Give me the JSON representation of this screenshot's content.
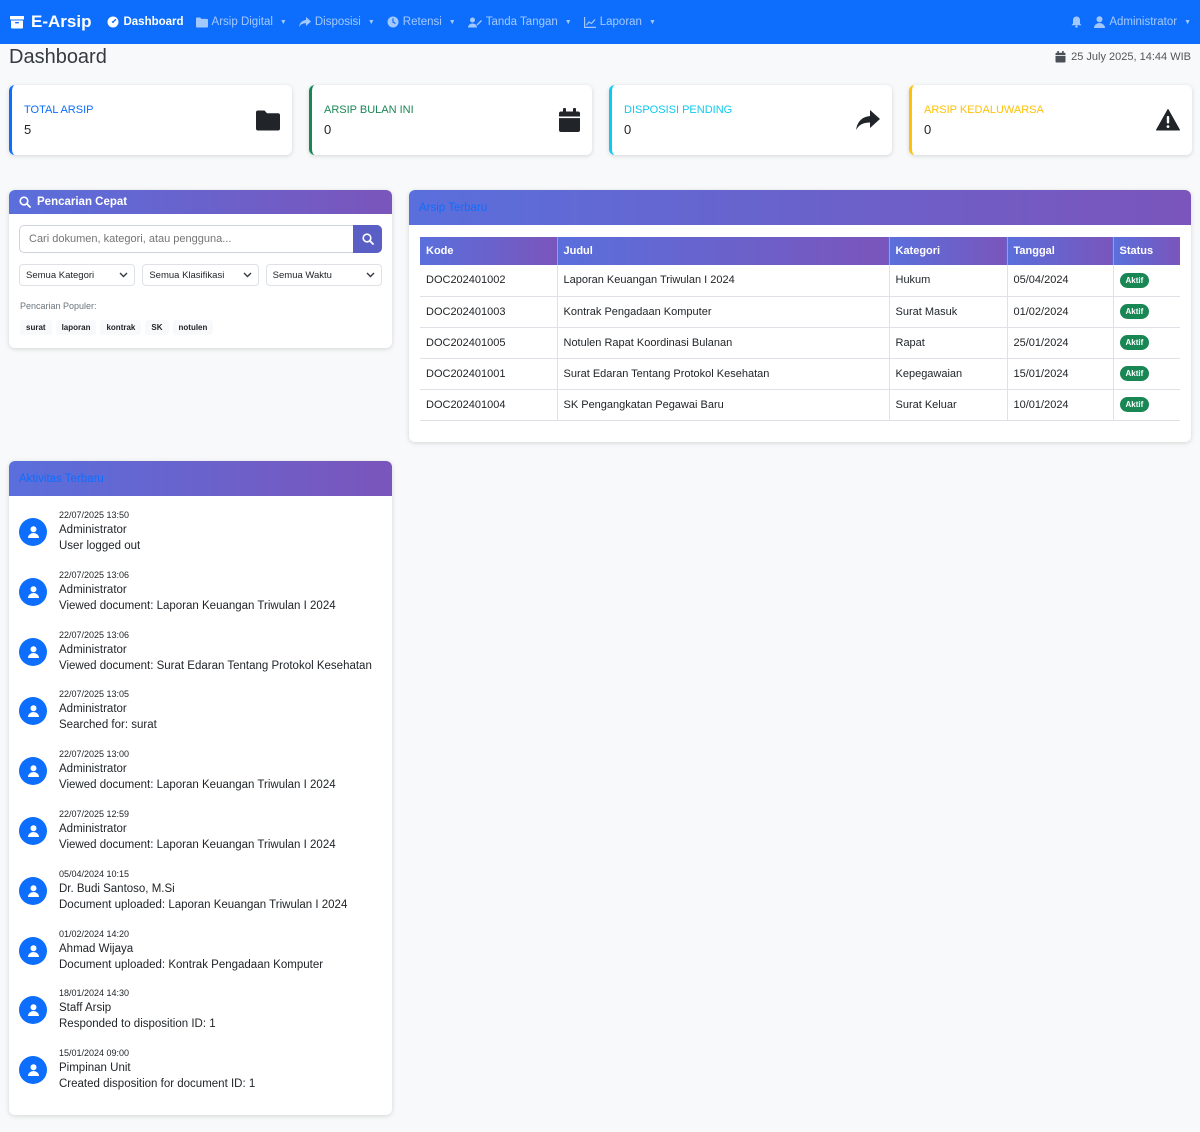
{
  "nav": {
    "brand": "E-Arsip",
    "items": [
      {
        "label": "Dashboard",
        "icon": "dashboard-icon"
      },
      {
        "label": "Arsip Digital",
        "icon": "folder-icon"
      },
      {
        "label": "Disposisi",
        "icon": "share-icon"
      },
      {
        "label": "Retensi",
        "icon": "clock-icon"
      },
      {
        "label": "Tanda Tangan",
        "icon": "signature-icon"
      },
      {
        "label": "Laporan",
        "icon": "chart-icon"
      }
    ],
    "user": "Administrator"
  },
  "page": {
    "title": "Dashboard",
    "datetime": "25 July 2025, 14:44 WIB"
  },
  "stats": [
    {
      "label": "TOTAL ARSIP",
      "value": "5",
      "color": "#0d6efd",
      "icon": "folder-icon"
    },
    {
      "label": "ARSIP BULAN INI",
      "value": "0",
      "color": "#198754",
      "icon": "calendar-icon"
    },
    {
      "label": "DISPOSISI PENDING",
      "value": "0",
      "color": "#0dcaf0",
      "icon": "share-icon"
    },
    {
      "label": "ARSIP KEDALUWARSA",
      "value": "0",
      "color": "#ffc107",
      "icon": "warning-icon"
    }
  ],
  "search": {
    "title": "Pencarian Cepat",
    "placeholder": "Cari dokumen, kategori, atau pengguna...",
    "filters": [
      "Semua Kategori",
      "Semua Klasifikasi",
      "Semua Waktu"
    ],
    "popular_label": "Pencarian Populer:",
    "tags": [
      "surat",
      "laporan",
      "kontrak",
      "SK",
      "notulen"
    ]
  },
  "recent_archives": {
    "title": "Arsip Terbaru",
    "columns": [
      "Kode",
      "Judul",
      "Kategori",
      "Tanggal",
      "Status"
    ],
    "rows": [
      {
        "kode": "DOC202401002",
        "judul": "Laporan Keuangan Triwulan I 2024",
        "kategori": "Hukum",
        "tanggal": "05/04/2024",
        "status": "Aktif"
      },
      {
        "kode": "DOC202401003",
        "judul": "Kontrak Pengadaan Komputer",
        "kategori": "Surat Masuk",
        "tanggal": "01/02/2024",
        "status": "Aktif"
      },
      {
        "kode": "DOC202401005",
        "judul": "Notulen Rapat Koordinasi Bulanan",
        "kategori": "Rapat",
        "tanggal": "25/01/2024",
        "status": "Aktif"
      },
      {
        "kode": "DOC202401001",
        "judul": "Surat Edaran Tentang Protokol Kesehatan",
        "kategori": "Kepegawaian",
        "tanggal": "15/01/2024",
        "status": "Aktif"
      },
      {
        "kode": "DOC202401004",
        "judul": "SK Pengangkatan Pegawai Baru",
        "kategori": "Surat Keluar",
        "tanggal": "10/01/2024",
        "status": "Aktif"
      }
    ]
  },
  "activity": {
    "title": "Aktivitas Terbaru",
    "items": [
      {
        "time": "22/07/2025 13:50",
        "user": "Administrator",
        "desc": "User logged out"
      },
      {
        "time": "22/07/2025 13:06",
        "user": "Administrator",
        "desc": "Viewed document: Laporan Keuangan Triwulan I 2024"
      },
      {
        "time": "22/07/2025 13:06",
        "user": "Administrator",
        "desc": "Viewed document: Surat Edaran Tentang Protokol Kesehatan"
      },
      {
        "time": "22/07/2025 13:05",
        "user": "Administrator",
        "desc": "Searched for: surat"
      },
      {
        "time": "22/07/2025 13:00",
        "user": "Administrator",
        "desc": "Viewed document: Laporan Keuangan Triwulan I 2024"
      },
      {
        "time": "22/07/2025 12:59",
        "user": "Administrator",
        "desc": "Viewed document: Laporan Keuangan Triwulan I 2024"
      },
      {
        "time": "05/04/2024 10:15",
        "user": "Dr. Budi Santoso, M.Si",
        "desc": "Document uploaded: Laporan Keuangan Triwulan I 2024"
      },
      {
        "time": "01/02/2024 14:20",
        "user": "Ahmad Wijaya",
        "desc": "Document uploaded: Kontrak Pengadaan Komputer"
      },
      {
        "time": "18/01/2024 14:30",
        "user": "Staff Arsip",
        "desc": "Responded to disposition ID: 1"
      },
      {
        "time": "15/01/2024 09:00",
        "user": "Pimpinan Unit",
        "desc": "Created disposition for document ID: 1"
      }
    ]
  }
}
